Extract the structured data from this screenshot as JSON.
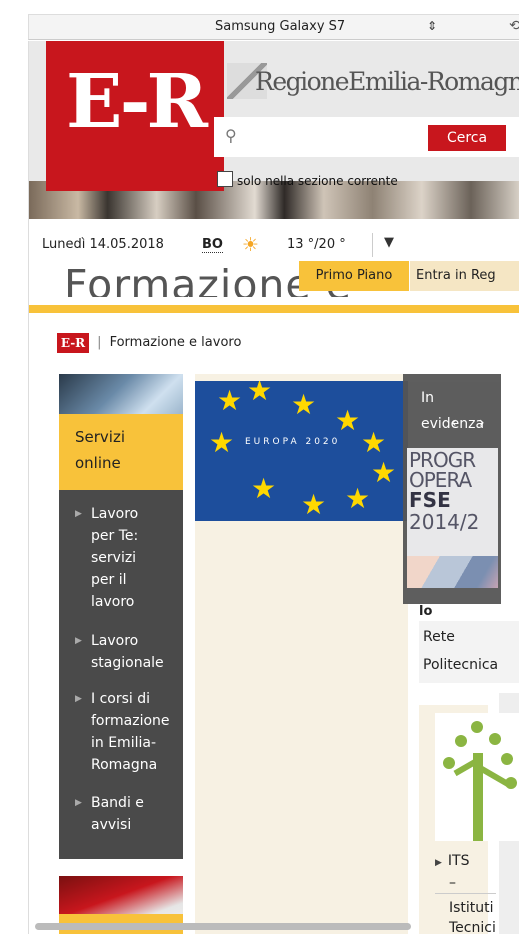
{
  "device_bar": {
    "device_name": "Samsung Galaxy S7",
    "selector_glyph": "⇕",
    "rotate_glyph": "⟲"
  },
  "header": {
    "logo_text": "E-R",
    "region_name": "RegioneEmilia-Romagna",
    "search": {
      "placeholder": "",
      "value": "",
      "button_label": "Cerca"
    },
    "section_only_label": "solo nella sezione corrente"
  },
  "datebar": {
    "date": "Lunedì 14.05.2018",
    "province": "BO",
    "temperature": "13 °/20 °"
  },
  "tabs": {
    "primo_piano": "Primo Piano",
    "entra": "Entra in Reg"
  },
  "page_title": "Formazione e",
  "breadcrumb": {
    "mini_logo": "E-R",
    "separator": "|",
    "current": "Formazione e lavoro"
  },
  "left_column": {
    "servizi_line1": "Servizi",
    "servizi_line2": "online",
    "menu": [
      {
        "lines": [
          "Lavoro",
          "per Te:",
          "servizi",
          "per il",
          "lavoro"
        ]
      },
      {
        "lines": [
          "Lavoro",
          "stagionale"
        ]
      },
      {
        "lines": [
          "I corsi di",
          "formazione",
          "in Emilia-",
          "Romagna"
        ]
      },
      {
        "lines": [
          "Bandi e",
          "avvisi"
        ]
      }
    ]
  },
  "center": {
    "eu_text": "EUROPA 2020"
  },
  "evidenza": {
    "line1": "In",
    "line2": "evidenza",
    "poster_title_1": "PROGR",
    "poster_title_2": "OPERA",
    "poster_fse": "FSE",
    "poster_years": "2014/2"
  },
  "right_column": {
    "io_text": "lo",
    "rete_line1": "Rete",
    "rete_line2": "Politecnica",
    "its_label": "ITS",
    "its_dash": "–",
    "its_istituti": "Istituti",
    "its_tecnici": "Tecnici"
  },
  "colors": {
    "brand_red": "#c8161d",
    "accent_yellow": "#f8c23a",
    "menu_dark": "#4a4a4a"
  }
}
